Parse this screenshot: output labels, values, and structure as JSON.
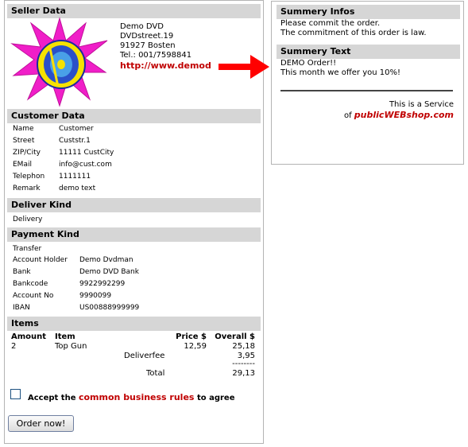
{
  "left": {
    "seller_header": "Seller Data",
    "seller": {
      "name": "Demo DVD",
      "street": "DVDstreet.19",
      "city": "91927 Bosten",
      "tel": "Tel.: 001/7598841",
      "url": "http://www.demod"
    },
    "customer_header": "Customer Data",
    "customer": [
      {
        "label": "Name",
        "value": "Customer"
      },
      {
        "label": "Street",
        "value": "Custstr.1"
      },
      {
        "label": "ZIP/City",
        "value": "11111 CustCity"
      },
      {
        "label": "EMail",
        "value": "info@cust.com"
      },
      {
        "label": "Telephon",
        "value": "1111111"
      },
      {
        "label": "Remark",
        "value": "demo text"
      }
    ],
    "deliver_header": "Deliver Kind",
    "deliver_value": "Delivery",
    "payment_header": "Payment Kind",
    "payment_type": "Transfer",
    "payment": [
      {
        "label": "Account Holder",
        "value": "Demo Dvdman"
      },
      {
        "label": "Bank",
        "value": "Demo DVD Bank"
      },
      {
        "label": "Bankcode",
        "value": "9922992299"
      },
      {
        "label": "Account No",
        "value": "9990099"
      },
      {
        "label": "IBAN",
        "value": "US00888999999"
      }
    ],
    "items_header": "Items",
    "items_cols": {
      "amount": "Amount",
      "item": "Item",
      "price": "Price $",
      "overall": "Overall $"
    },
    "item_row": {
      "amount": "2",
      "item": "Top Gun",
      "price": "12,59",
      "overall": "25,18"
    },
    "deliverfee_label": "Deliverfee",
    "deliverfee_value": "3,95",
    "dashes": "--------",
    "total_label": "Total",
    "total_value": "29,13",
    "accept_pre": "Accept the",
    "accept_link": "common business rules",
    "accept_post": "to agree",
    "order_button": "Order now!"
  },
  "right": {
    "summary_header": "Summery Infos",
    "summary_line1": "Please commit the order.",
    "summary_line2": "The commitment of this order is law.",
    "text_header": "Summery Text",
    "text_line1": "DEMO Order!!",
    "text_line2": "This month we offer you 10%!",
    "service_line1": "This is a Service",
    "service_of": "of",
    "service_brand": "publicWEBshop.com"
  },
  "colors": {
    "header_bg": "#d6d6d6",
    "accent_red": "#c00000",
    "arrow_red": "#ff0000"
  }
}
